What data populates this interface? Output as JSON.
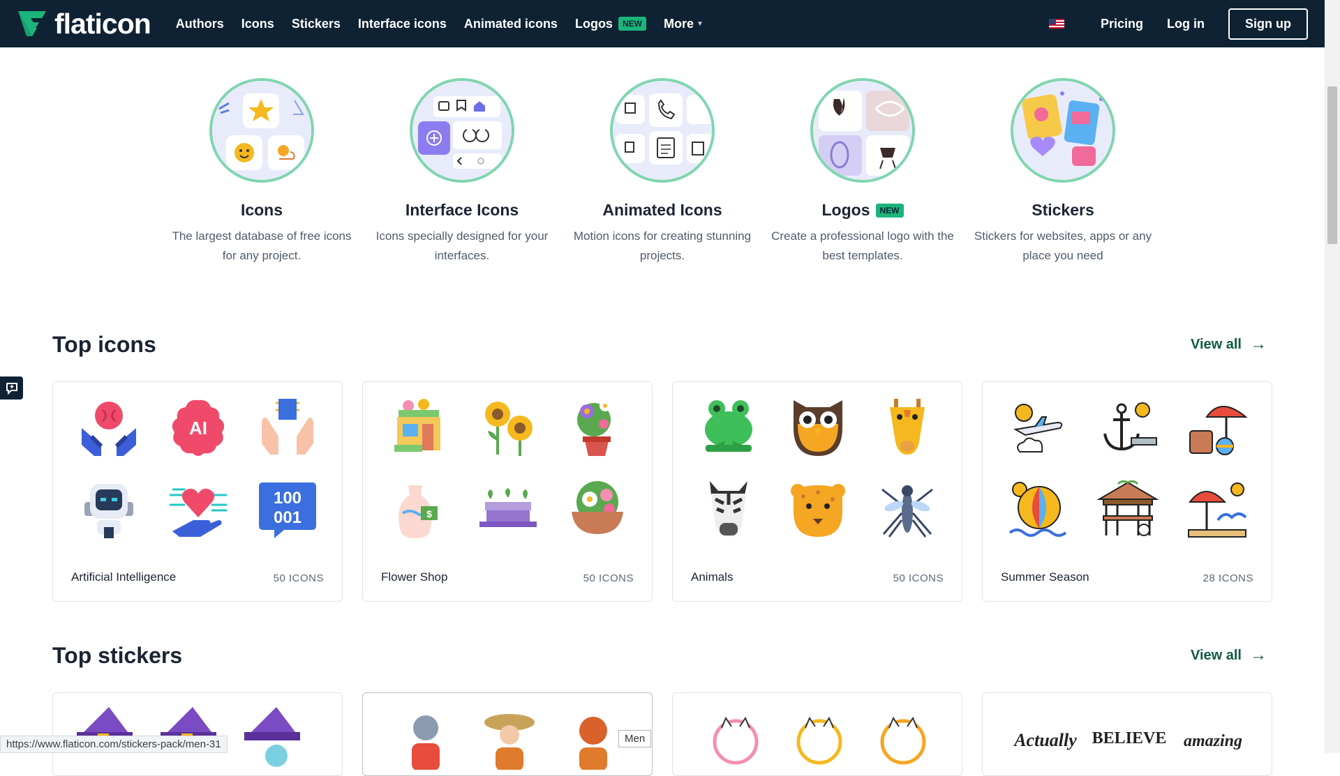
{
  "header": {
    "logo_text": "flaticon",
    "nav": [
      {
        "label": "Authors"
      },
      {
        "label": "Icons"
      },
      {
        "label": "Stickers"
      },
      {
        "label": "Interface icons"
      },
      {
        "label": "Animated icons"
      },
      {
        "label": "Logos",
        "badge": "NEW"
      },
      {
        "label": "More"
      }
    ],
    "pricing": "Pricing",
    "login": "Log in",
    "signup": "Sign up"
  },
  "categories": [
    {
      "title": "Icons",
      "desc": "The largest database of free icons for any project."
    },
    {
      "title": "Interface Icons",
      "desc": "Icons specially designed for your interfaces."
    },
    {
      "title": "Animated Icons",
      "desc": "Motion icons for creating stunning projects."
    },
    {
      "title": "Logos",
      "badge": "NEW",
      "desc": "Create a professional logo with the best templates."
    },
    {
      "title": "Stickers",
      "desc": "Stickers for websites, apps or any place you need"
    }
  ],
  "top_icons": {
    "title": "Top icons",
    "view_all": "View all",
    "packs": [
      {
        "name": "Artificial Intelligence",
        "count": "50 ICONS"
      },
      {
        "name": "Flower Shop",
        "count": "50 ICONS"
      },
      {
        "name": "Animals",
        "count": "50 ICONS"
      },
      {
        "name": "Summer Season",
        "count": "28 ICONS"
      }
    ]
  },
  "top_stickers": {
    "title": "Top stickers",
    "view_all": "View all"
  },
  "status_bar_url": "https://www.flaticon.com/stickers-pack/men-31",
  "tooltip": "Men",
  "colors": {
    "header_bg": "#0e2233",
    "accent": "#1bb57b",
    "link_green": "#0e5a44"
  }
}
